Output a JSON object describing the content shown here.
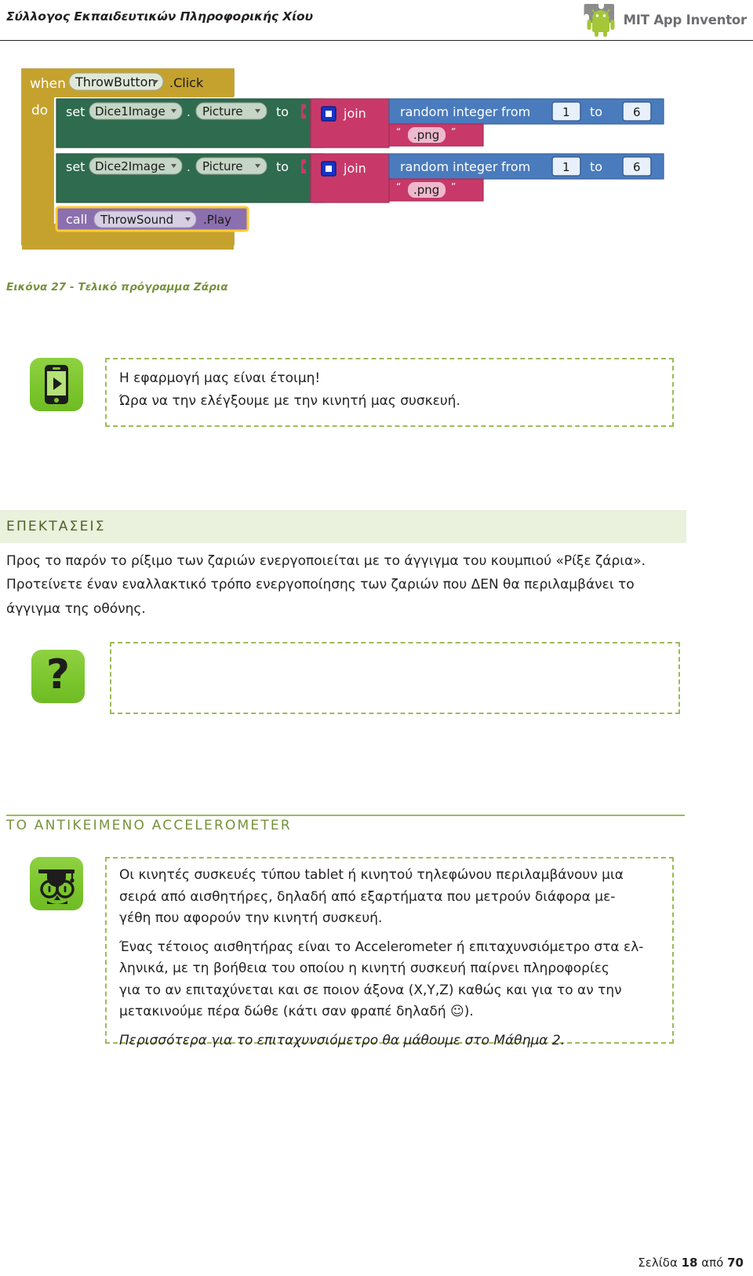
{
  "header": {
    "title": "Σύλλογος Εκπαιδευτικών Πληροφορικής Χίου",
    "logo_text": "MIT App Inventor",
    "logo_icon": "app-inventor-android-logo"
  },
  "figure": {
    "caption": "Εικόνα 27 - Τελικό πρόγραμμα Ζάρια",
    "blocks": {
      "when": "when",
      "event_component": "ThrowButton",
      "event_name": ".Click",
      "do": "do",
      "rows": [
        {
          "set": "set",
          "component": "Dice1Image",
          "property": "Picture",
          "to": "to",
          "join": "join",
          "random_label": "random integer",
          "from": "from",
          "from_value": "1",
          "to_word": "to",
          "to_value": "6",
          "text_value": ".png",
          "quote_open": "“",
          "quote_close": "”"
        },
        {
          "set": "set",
          "component": "Dice2Image",
          "property": "Picture",
          "to": "to",
          "join": "join",
          "random_label": "random integer",
          "from": "from",
          "from_value": "1",
          "to_word": "to",
          "to_value": "6",
          "text_value": ".png",
          "quote_open": "“",
          "quote_close": "”"
        }
      ],
      "call": "call",
      "call_component": "ThrowSound",
      "call_method": ".Play"
    }
  },
  "callout_ready": {
    "icon": "phone-play-icon",
    "lines": [
      "Η εφαρμογή μας είναι έτοιμη!",
      "Ώρα να την ελέγξουμε με την κινητή μας συσκευή."
    ]
  },
  "section_extensions": {
    "heading": "ΕΠΕΚΤΑΣΕΙΣ",
    "paragraph_lines": [
      "Προς το παρόν το ρίξιμο των ζαριών ενεργοποιείται με το άγγιγμα του κουμπιού «Ρίξε ζάρια».",
      "Προτείνετε έναν εναλλακτικό τρόπο ενεργοποίησης των ζαριών που ΔΕΝ θα περιλαμβάνει το",
      "άγγιγμα της οθόνης."
    ],
    "answer_icon": "question-mark-icon",
    "answer_box_text": ""
  },
  "section_accelerometer": {
    "heading": "ΤΟ ΑΝΤΙΚΕΙΜΕΝΟ ACCELEROMETER",
    "icon": "owl-graduate-icon",
    "paragraphs": [
      {
        "style": "normal",
        "lines": [
          "Οι κινητές συσκευές τύπου tablet ή κινητού τηλεφώνου περιλαμβάνουν μια",
          "σειρά από αισθητήρες, δηλαδή από εξαρτήματα που μετρούν διάφορα με-",
          "γέθη που αφορούν την κινητή συσκευή."
        ]
      },
      {
        "style": "normal",
        "lines": [
          "Ένας τέτοιος αισθητήρας είναι το Accelerometer ή επιταχυνσιόμετρο στα ελ-",
          "ληνικά, με τη βοήθεια του οποίου η κινητή συσκευή παίρνει πληροφορίες",
          "για το αν επιταχύνεται και σε ποιον άξονα (X,Y,Z) καθώς και για το αν την",
          "μετακινούμε πέρα δώθε (κάτι σαν φραπέ δηλαδή ☺)."
        ]
      },
      {
        "style": "italic",
        "lines": [
          "Περισσότερα για το επιταχυνσιόμετρο θα μάθουμε στο Μάθημα 2."
        ]
      }
    ]
  },
  "footer": {
    "prefix": "Σελίδα ",
    "page": "18",
    "middle": " από ",
    "total": "70"
  },
  "colors": {
    "accent_green": "#9bbb59",
    "heading_green": "#76923c",
    "dark_green": "#4f6228",
    "band_green": "#eaf1dd",
    "icon_green": "#7cc62e",
    "block_event": "#c5a22e",
    "block_set": "#2f6b4f",
    "block_text": "#c8396a",
    "block_math": "#4a7bbd",
    "block_call": "#8b6fae",
    "logo_grey": "#6d6e71"
  }
}
